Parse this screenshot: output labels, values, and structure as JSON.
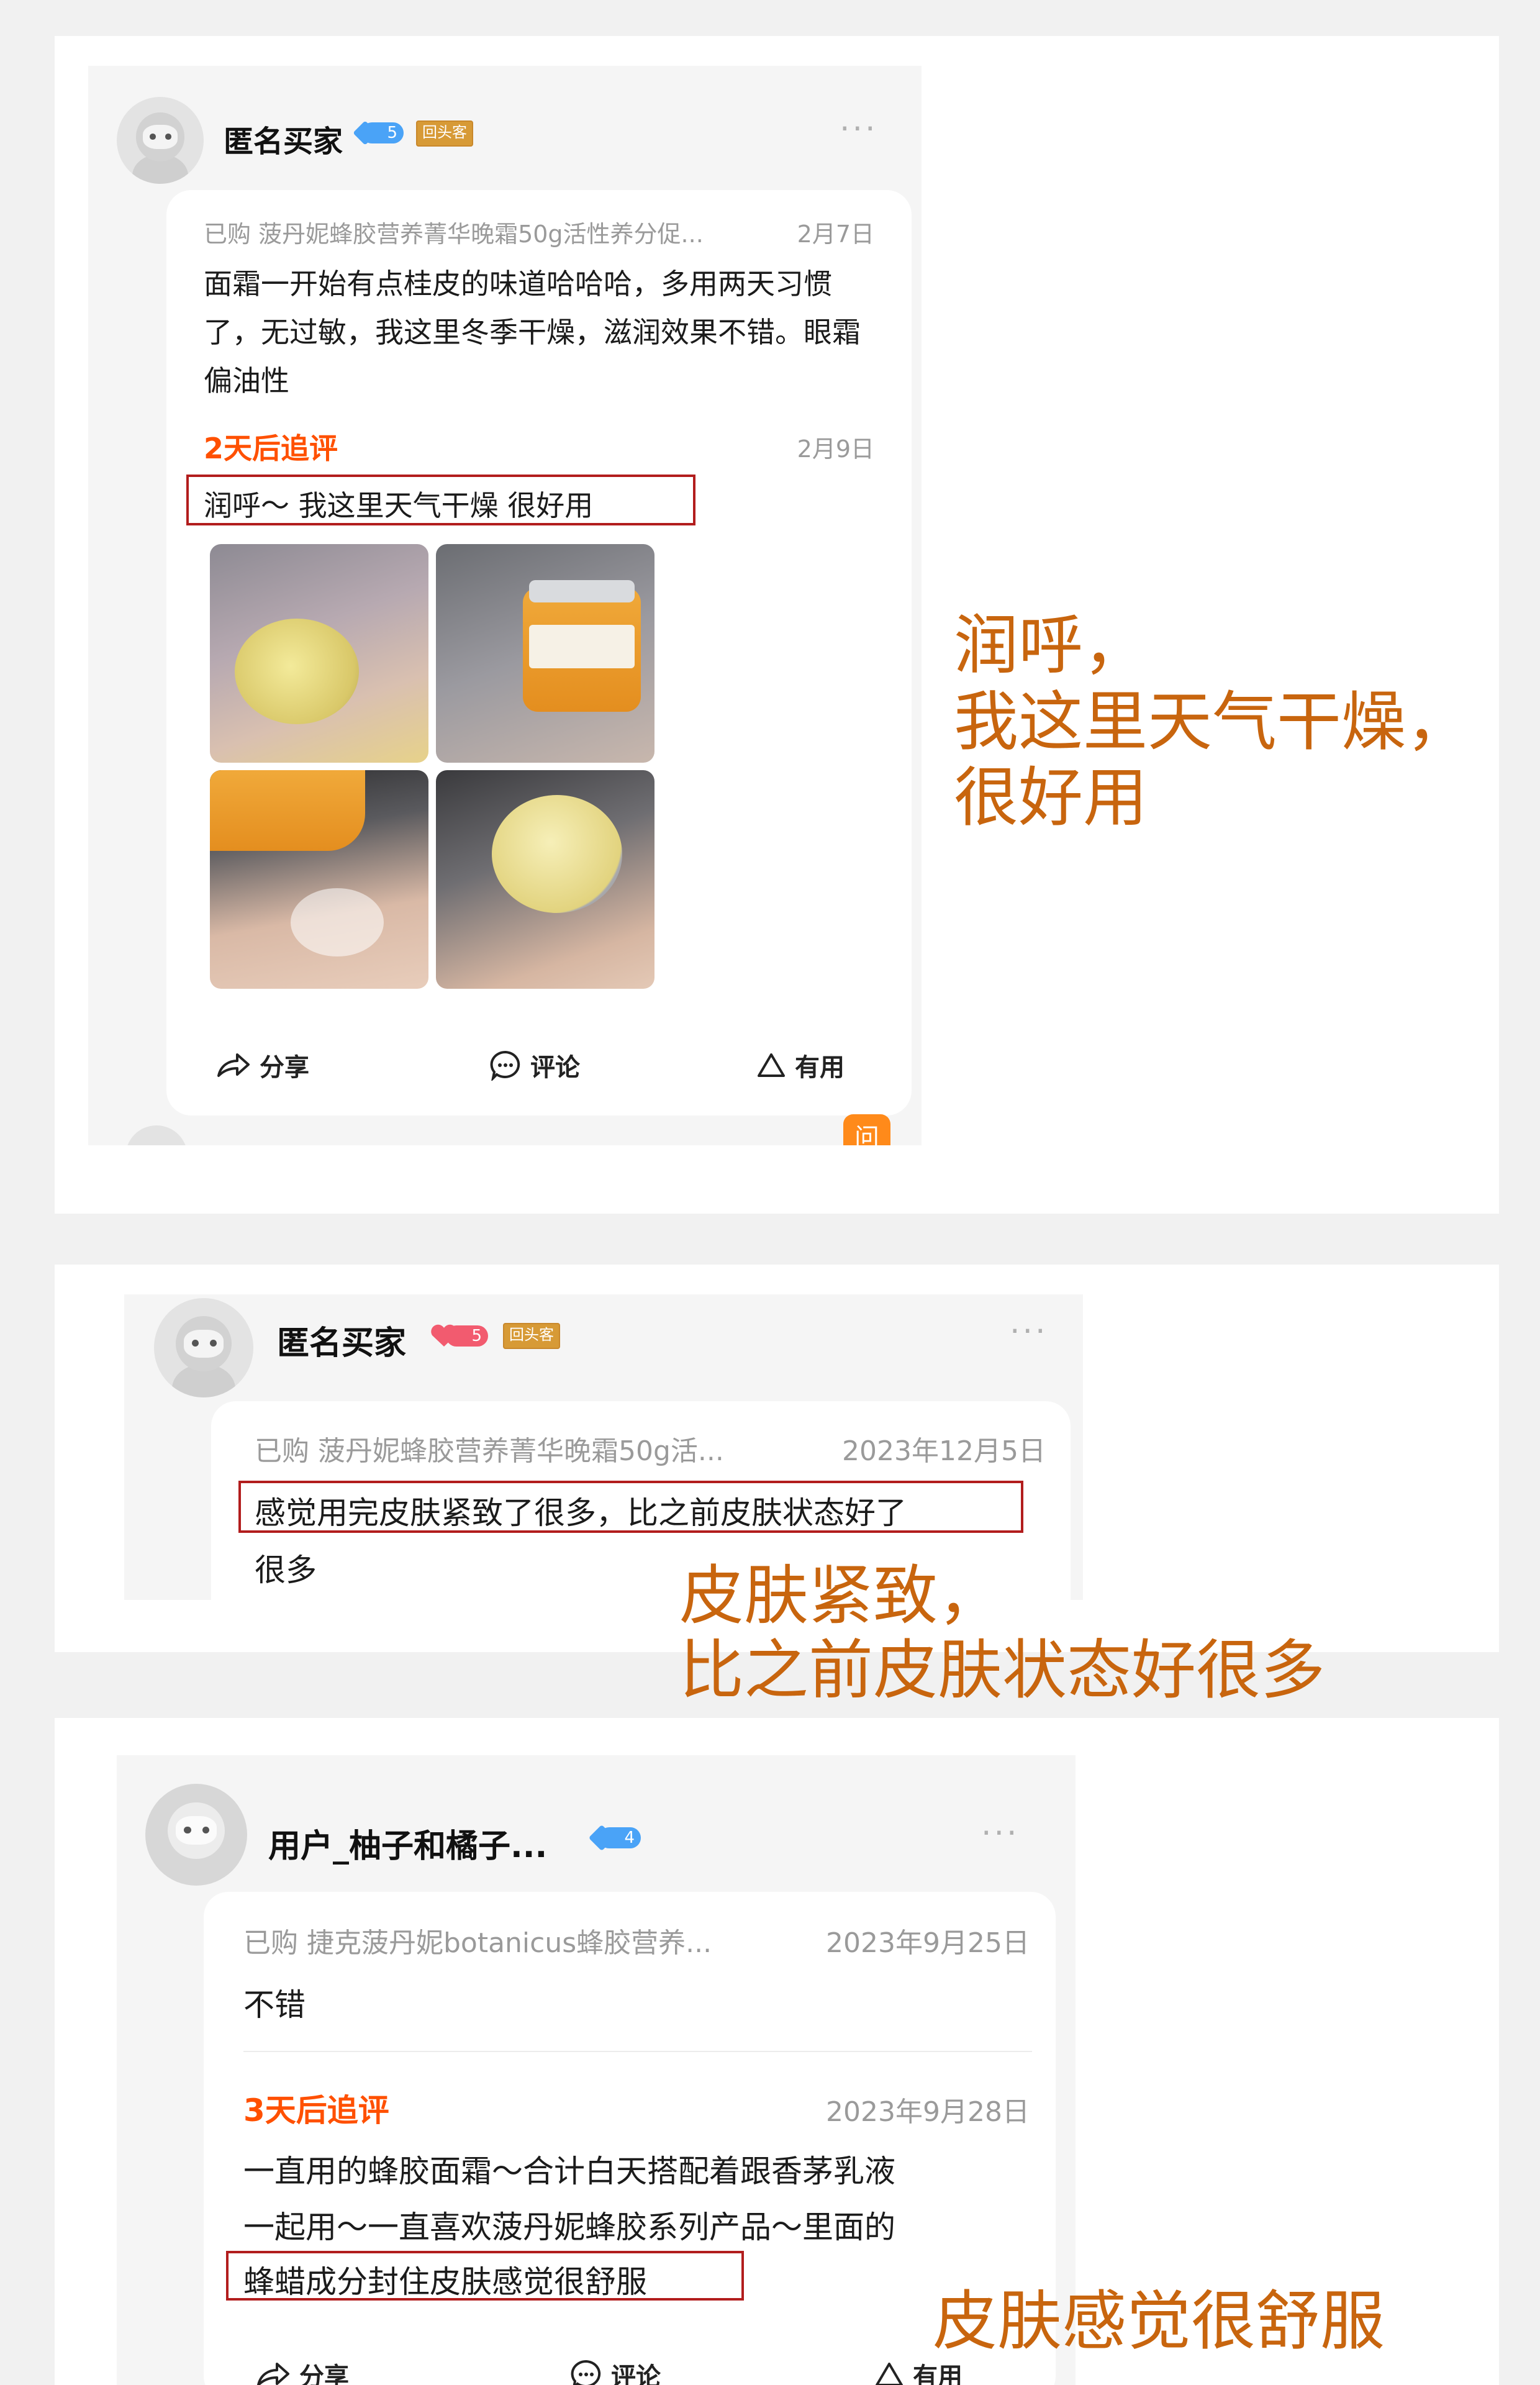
{
  "review1": {
    "username": "匿名买家",
    "level": "5",
    "level_color": "#4aa3f7",
    "badge": "回头客",
    "more": "···",
    "purchased": "已购 菠丹妮蜂胶营养菁华晚霜50g活性养分促...",
    "date": "2月7日",
    "body": "面霜一开始有点桂皮的味道哈哈哈，多用两天习惯了，无过敏，我这里冬季干燥，滋润效果不错。眼霜偏油性",
    "followup_label": "2天后追评",
    "followup_date": "2月9日",
    "followup_text": "润呼～ 我这里天气干燥 很好用",
    "photos": [
      "cream-jar-open-in-hand",
      "cream-jar-lid-in-hand",
      "cream-applied-on-palm",
      "cream-jar-open-closeup"
    ],
    "actions": {
      "share": "分享",
      "comment": "评论",
      "useful": "有用"
    },
    "partial_next_icon": "问"
  },
  "annotation1": {
    "lines": [
      "润呼，",
      "我这里天气干燥，",
      "很好用"
    ]
  },
  "review2": {
    "username": "匿名买家",
    "level": "5",
    "level_color": "#f25b6f",
    "badge": "回头客",
    "more": "···",
    "purchased": "已购 菠丹妮蜂胶营养菁华晚霜50g活...",
    "date": "2023年12月5日",
    "highlight_text": "感觉用完皮肤紧致了很多，比之前皮肤状态好了",
    "body_rest": "很多"
  },
  "annotation2": {
    "lines": [
      "皮肤紧致，",
      "比之前皮肤状态好很多"
    ]
  },
  "review3": {
    "username": "用户_柚子和橘子...",
    "level": "4",
    "level_color": "#4aa3f7",
    "more": "···",
    "purchased": "已购 捷克菠丹妮botanicus蜂胶营养...",
    "date": "2023年9月25日",
    "body": "不错",
    "followup_label": "3天后追评",
    "followup_date": "2023年9月28日",
    "followup_line1": "一直用的蜂胶面霜～合计白天搭配着跟香茅乳液",
    "followup_line2": "一起用～一直喜欢菠丹妮蜂胶系列产品～里面的",
    "highlight_text": "蜂蜡成分封住皮肤感觉很舒服",
    "actions": {
      "share": "分享",
      "comment": "评论",
      "useful": "有用"
    }
  },
  "annotation3": {
    "text": "皮肤感觉很舒服"
  },
  "colors": {
    "annotation": "#c8650e",
    "highlight_border": "#b21d1d",
    "followup": "#ff5000"
  }
}
